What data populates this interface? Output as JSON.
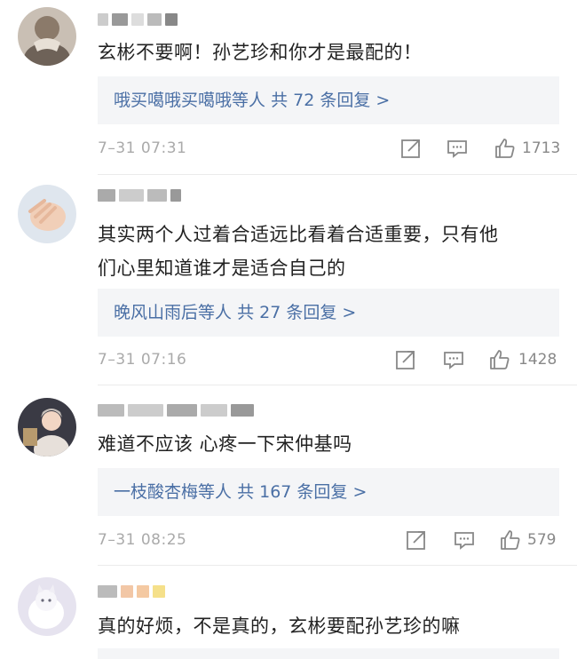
{
  "comments": [
    {
      "username": "",
      "content": "玄彬不要啊！孙艺珍和你才是最配的！",
      "replies": {
        "who": "哦买噶哦买噶哦等人",
        "count": "共 72 条回复 >"
      },
      "time": "7–31 07:31",
      "likes": "1713"
    },
    {
      "username": "",
      "content_lines": [
        "其实两个人过着合适远比看着合适重要，只有他",
        "们心里知道谁才是适合自己的"
      ],
      "replies": {
        "who": "晚风山雨后等人",
        "count": "共 27 条回复 >"
      },
      "time": "7–31 07:16",
      "likes": "1428"
    },
    {
      "username": "",
      "content": "难道不应该 心疼一下宋仲基吗",
      "replies": {
        "who": "一枝酸杏梅等人",
        "count": "共 167 条回复 >"
      },
      "time": "7–31 08:25",
      "likes": "579"
    },
    {
      "username": "",
      "content": "真的好烦，不是真的，玄彬要配孙艺珍的嘛"
    }
  ],
  "icons": {
    "repost": "share-icon",
    "comment": "comment-icon",
    "like": "thumbs-up-icon"
  },
  "colors": {
    "link": "#4a6fa5",
    "reply_bg": "#f4f5f7",
    "meta": "#aaaaaa"
  }
}
